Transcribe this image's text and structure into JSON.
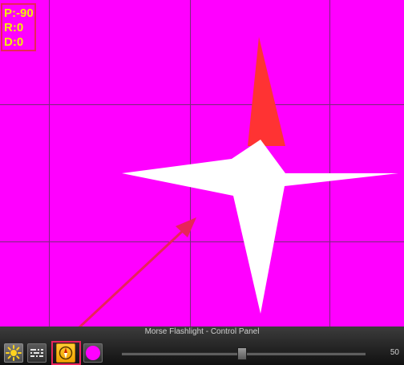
{
  "readout": {
    "pitch": "P:-90",
    "roll": "R:0",
    "direction": "D:0",
    "text_color": "#f2f200"
  },
  "canvas": {
    "background_color": "#ff00ff",
    "grid_color": "#7a2a7a",
    "star_color": "#ffffff",
    "needle_color": "#ff3333",
    "annotation_color": "#e8245a"
  },
  "control_panel": {
    "title": "Morse Flashlight - Control Panel",
    "buttons": [
      {
        "name": "flashlight-button",
        "icon": "sun-icon"
      },
      {
        "name": "morse-button",
        "icon": "morse-code-icon"
      },
      {
        "name": "compass-button",
        "icon": "compass-icon",
        "selected": true
      },
      {
        "name": "color-button",
        "icon": "color-circle-icon",
        "color": "#ff00ff"
      }
    ],
    "slider": {
      "value": 50,
      "value_label": "50",
      "min": 0,
      "max": 100
    }
  }
}
